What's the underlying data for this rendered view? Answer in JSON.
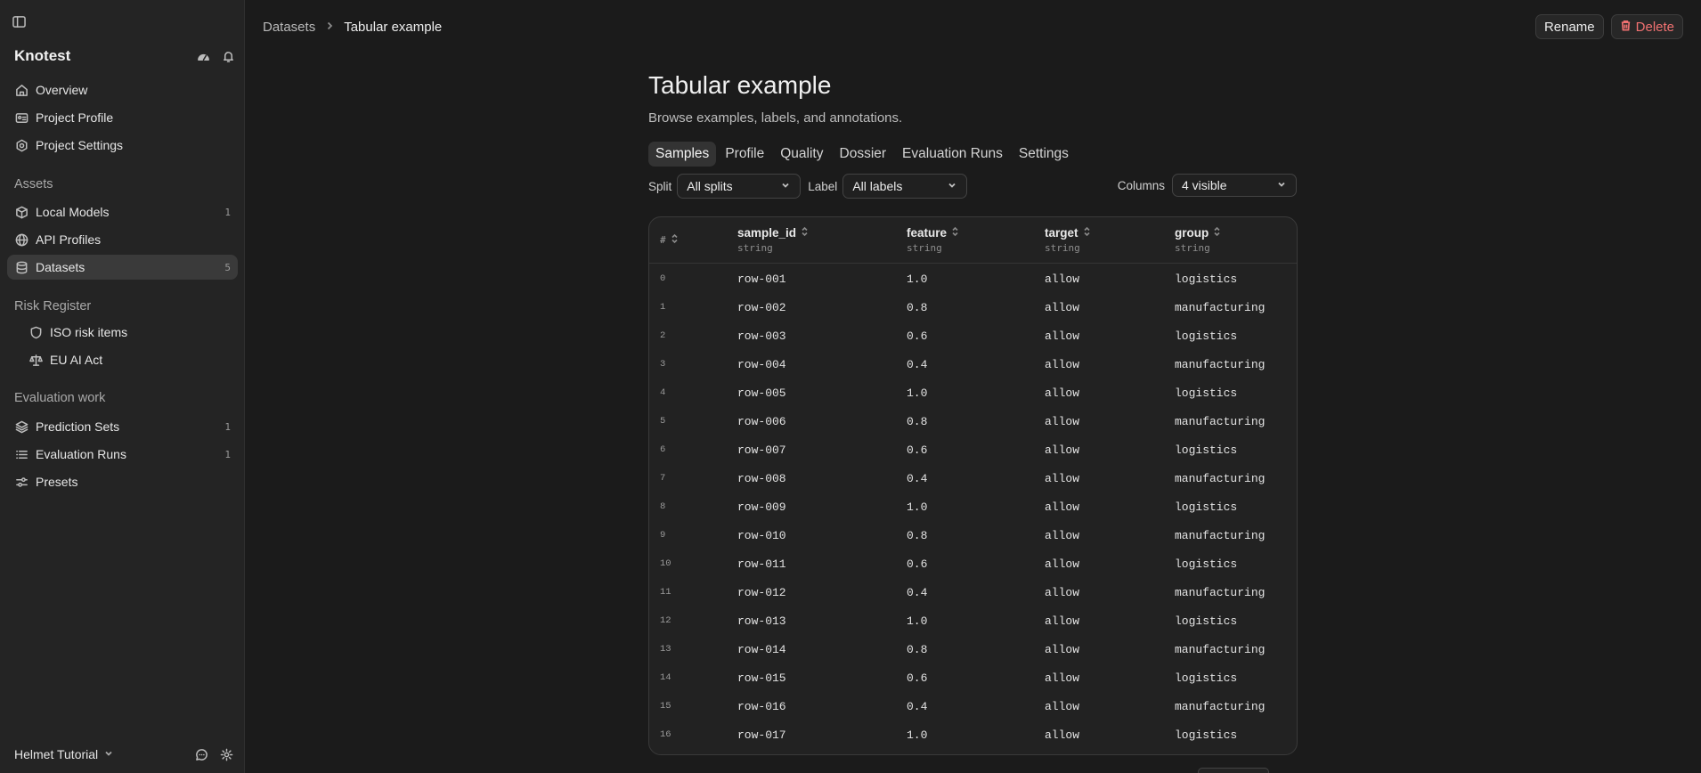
{
  "sidebar": {
    "brand": "Knotest",
    "items": [
      {
        "label": "Overview",
        "icon": "home-icon",
        "count": ""
      },
      {
        "label": "Project Profile",
        "icon": "id-card-icon",
        "count": ""
      },
      {
        "label": "Project Settings",
        "icon": "settings-icon",
        "count": ""
      }
    ],
    "groups": {
      "assets": {
        "title": "Assets",
        "items": [
          {
            "label": "Local Models",
            "icon": "box-icon",
            "count": "1"
          },
          {
            "label": "API Profiles",
            "icon": "globe-icon",
            "count": ""
          },
          {
            "label": "Datasets",
            "icon": "database-icon",
            "count": "5"
          }
        ]
      },
      "risk": {
        "title": "Risk Register",
        "items": [
          {
            "label": "ISO risk items",
            "icon": "shield-icon"
          },
          {
            "label": "EU AI Act",
            "icon": "scale-icon"
          }
        ]
      },
      "evaluation": {
        "title": "Evaluation work",
        "items": [
          {
            "label": "Prediction Sets",
            "icon": "layers-icon",
            "count": "1"
          },
          {
            "label": "Evaluation Runs",
            "icon": "list-icon",
            "count": "1"
          },
          {
            "label": "Presets",
            "icon": "sliders-icon",
            "count": ""
          }
        ]
      }
    },
    "workspace": "Helmet Tutorial"
  },
  "header": {
    "breadcrumb_parent": "Datasets",
    "breadcrumb_current": "Tabular example",
    "rename_label": "Rename",
    "delete_label": "Delete"
  },
  "page": {
    "title": "Tabular example",
    "subtitle": "Browse examples, labels, and annotations.",
    "tabs": [
      "Samples",
      "Profile",
      "Quality",
      "Dossier",
      "Evaluation Runs",
      "Settings"
    ],
    "active_tab": "Samples"
  },
  "filters": {
    "split_label": "Split",
    "split_value": "All splits",
    "label_label": "Label",
    "label_value": "All labels",
    "columns_label": "Columns",
    "columns_value": "4 visible"
  },
  "table": {
    "index_header": "#",
    "columns": [
      {
        "name": "sample_id",
        "type": "string"
      },
      {
        "name": "feature",
        "type": "string"
      },
      {
        "name": "target",
        "type": "string"
      },
      {
        "name": "group",
        "type": "string"
      }
    ],
    "rows": [
      [
        "0",
        "row-001",
        "1.0",
        "allow",
        "logistics"
      ],
      [
        "1",
        "row-002",
        "0.8",
        "allow",
        "manufacturing"
      ],
      [
        "2",
        "row-003",
        "0.6",
        "allow",
        "logistics"
      ],
      [
        "3",
        "row-004",
        "0.4",
        "allow",
        "manufacturing"
      ],
      [
        "4",
        "row-005",
        "1.0",
        "allow",
        "logistics"
      ],
      [
        "5",
        "row-006",
        "0.8",
        "allow",
        "manufacturing"
      ],
      [
        "6",
        "row-007",
        "0.6",
        "allow",
        "logistics"
      ],
      [
        "7",
        "row-008",
        "0.4",
        "allow",
        "manufacturing"
      ],
      [
        "8",
        "row-009",
        "1.0",
        "allow",
        "logistics"
      ],
      [
        "9",
        "row-010",
        "0.8",
        "allow",
        "manufacturing"
      ],
      [
        "10",
        "row-011",
        "0.6",
        "allow",
        "logistics"
      ],
      [
        "11",
        "row-012",
        "0.4",
        "allow",
        "manufacturing"
      ],
      [
        "12",
        "row-013",
        "1.0",
        "allow",
        "logistics"
      ],
      [
        "13",
        "row-014",
        "0.8",
        "allow",
        "manufacturing"
      ],
      [
        "14",
        "row-015",
        "0.6",
        "allow",
        "logistics"
      ],
      [
        "15",
        "row-016",
        "0.4",
        "allow",
        "manufacturing"
      ],
      [
        "16",
        "row-017",
        "1.0",
        "allow",
        "logistics"
      ]
    ]
  },
  "colors": {
    "background": "#1b1b1b",
    "sidebar": "#242424",
    "active_item": "#3a3a3a",
    "danger": "#f07171"
  }
}
